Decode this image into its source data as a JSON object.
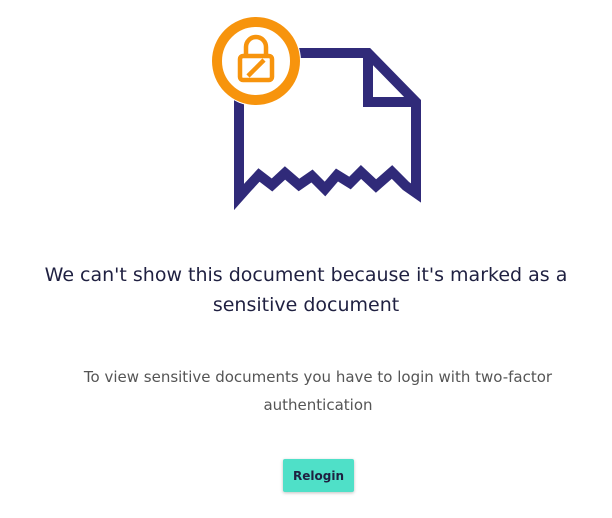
{
  "illustration": {
    "icon": "torn-document-icon",
    "badge_icon": "lock-disabled-icon",
    "document_color": "#302a79",
    "badge_color": "#f7940d"
  },
  "message": {
    "title": "We can't show this document because it's marked as a sensitive document",
    "subtitle": "To view sensitive documents you have to login with two-factor authentication"
  },
  "actions": {
    "relogin_label": "Relogin",
    "button_color": "#4fe0c8"
  }
}
